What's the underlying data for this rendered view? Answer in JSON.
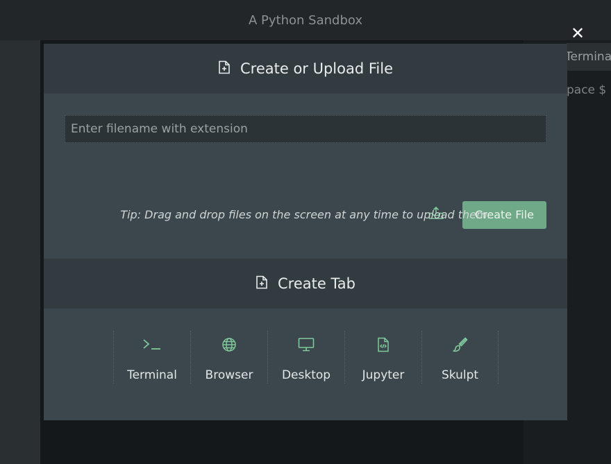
{
  "app": {
    "title": "A Python Sandbox"
  },
  "background": {
    "right_tab_label": "Terminal",
    "right_prompt_text": "pace $"
  },
  "modal": {
    "close_glyph": "✕",
    "file_section": {
      "title": "Create or Upload File",
      "filename_placeholder": "Enter filename with extension",
      "filename_value": "",
      "create_button_label": "Create File",
      "tip": "Tip: Drag and drop files on the screen at any time to upload them."
    },
    "tab_section": {
      "title": "Create Tab",
      "options": [
        {
          "label": "Terminal",
          "icon": "terminal-icon"
        },
        {
          "label": "Browser",
          "icon": "globe-icon"
        },
        {
          "label": "Desktop",
          "icon": "monitor-icon"
        },
        {
          "label": "Jupyter",
          "icon": "code-file-icon"
        },
        {
          "label": "Skulpt",
          "icon": "brush-icon"
        }
      ]
    }
  },
  "colors": {
    "accent_green": "#6fa987",
    "icon_green": "#7fc99a",
    "modal_bg": "#3b474c",
    "modal_header_bg": "#323c40"
  }
}
